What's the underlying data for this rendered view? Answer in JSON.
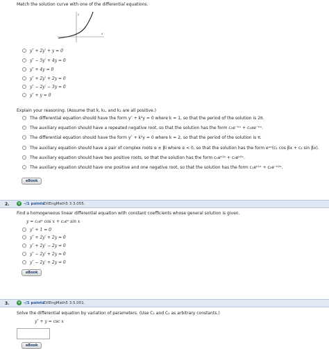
{
  "q1": {
    "prompt": "Match the solution curve with one of the differential equations.",
    "graph": {
      "y_label": "y",
      "x_label": "x"
    },
    "options": [
      "y″ + 2y′ + y = 0",
      "y″ − 5y′ + 4y = 0",
      "y″ + 4y = 0",
      "y″ + 2y′ + 2y = 0",
      "y″ − 2y′ − 3y = 0",
      "y″ + y = 0"
    ],
    "explain_prompt": "Explain your reasoning. (Assume that k, k₁, and k₂ are all positive.)",
    "reasons": [
      "The differential equation should have the form y″ + k²y = 0 where k = 1, so that the period of the solution is 2π.",
      "The auxiliary equation should have a repeated negative root, so that the solution has the form c₁e⁻ᵏˣ + c₂xe⁻ᵏˣ.",
      "The differential equation should have the form y″ + k²y = 0 where k = 2, so that the period of the solution is π.",
      "The auxiliary equation should have a pair of complex roots α ± βi where α < 0, so that the solution has the form eᵅˣ(c₁ cos βx + c₂ sin βx).",
      "The auxiliary equation should have two positive roots, so that the solution has the form c₁eᵏ¹ˣ + c₂eᵏ²ˣ.",
      "The auxiliary equation should have one positive and one negative root, so that the solution has the form c₁eᵏ¹ˣ + c₂e⁻ᵏ²ˣ."
    ],
    "ebook_label": "eBook"
  },
  "q2": {
    "number": "2.",
    "points": "–/1 points",
    "ref": "ZillEngMath5 3.3.055.",
    "prompt": "Find a homogeneous linear differential equation with constant coefficients whose general solution is given.",
    "given": "y = c₁eˣ cos x + c₂eˣ sin x",
    "options": [
      "y″ + 1 = 0",
      "y″ + 2y′ + 2y = 0",
      "y″ + 2y′ − 2y = 0",
      "y″ − 2y′ + 2y = 0",
      "y″ − 2y′ + 2y = 0"
    ],
    "ebook_label": "eBook"
  },
  "q3": {
    "number": "3.",
    "points": "–/1 points",
    "ref": "ZillEngMath5 3.5.001.",
    "prompt": "Solve the differential equation by variation of parameters. (Use C₁ and C₂ as arbitrary constants.)",
    "equation": "y″ + y = csc x",
    "answer_value": "",
    "ebook_label": "eBook"
  }
}
